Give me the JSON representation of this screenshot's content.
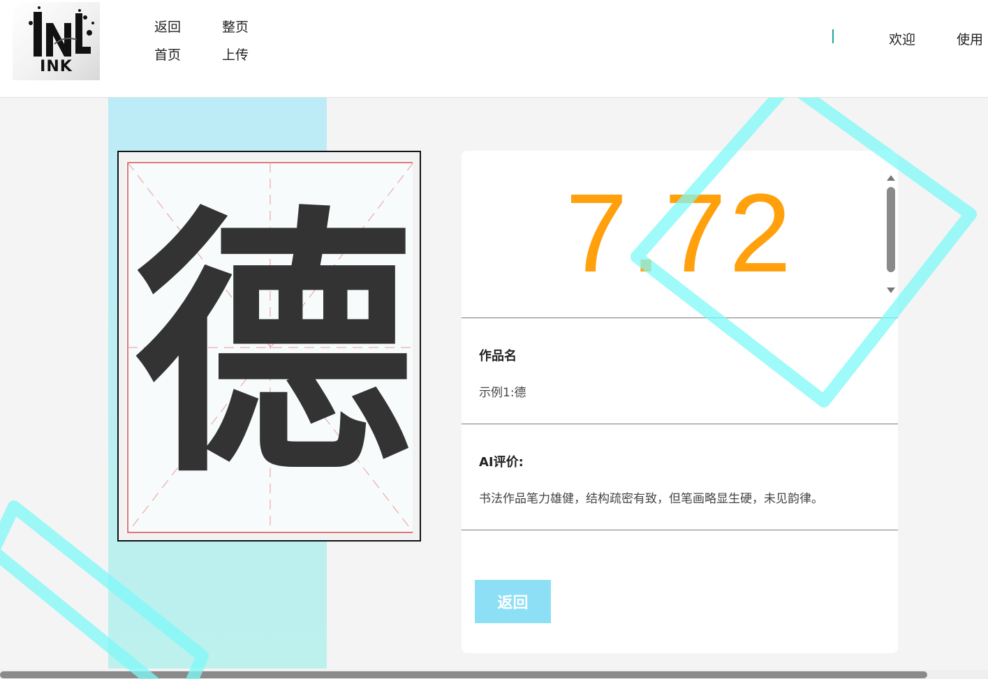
{
  "logo": {
    "text": "INK"
  },
  "nav": {
    "back": "返回",
    "full_page": "整页",
    "home": "首页",
    "upload": "上传"
  },
  "header_right": {
    "welcome": "欢迎",
    "usage": "使用"
  },
  "artwork": {
    "character": "德"
  },
  "result": {
    "score": "7.72",
    "work_name_label": "作品名",
    "work_name_value": "示例1:德",
    "ai_review_label": "AI评价:",
    "ai_review_text": "书法作品笔力雄健，结构疏密有致，但笔画略显生硬，未见韵律。",
    "back_button": "返回"
  },
  "colors": {
    "score": "#ffa00c",
    "button": "#8ddff5",
    "deco_cyan": "#7ff8f8",
    "accent": "#1ea59a"
  }
}
